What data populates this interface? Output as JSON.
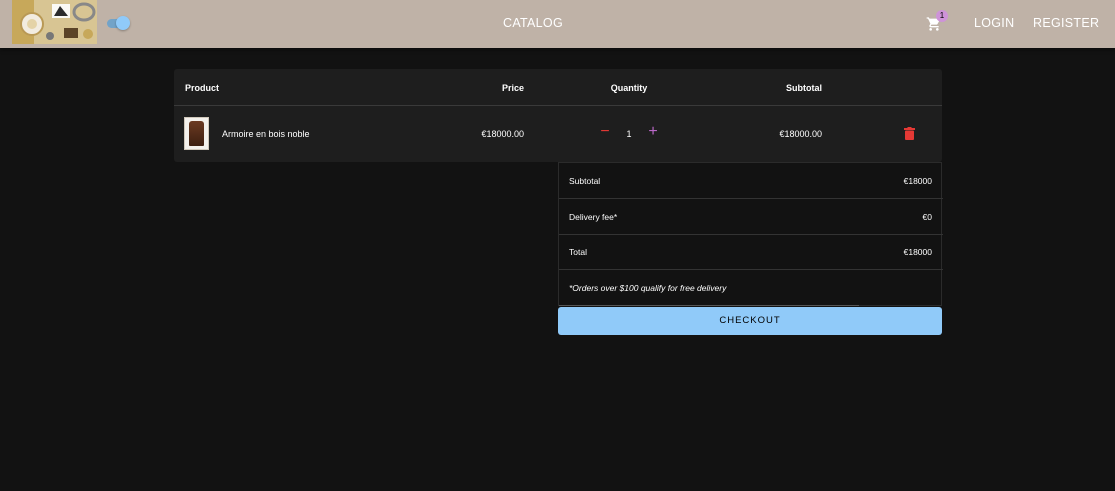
{
  "header": {
    "logo_icon": "shop-logo-image",
    "theme_toggle": {
      "checked": true,
      "color": "#90caf9"
    },
    "nav_center": "CATALOG",
    "cart": {
      "icon": "cart-icon",
      "badge": "1"
    },
    "login": "LOGIN",
    "register": "REGISTER",
    "background": "#bfb2a7"
  },
  "table": {
    "headers": {
      "product": "Product",
      "price": "Price",
      "quantity": "Quantity",
      "subtotal": "Subtotal"
    },
    "rows": [
      {
        "name": "Armoire en bois noble",
        "price": "€18000.00",
        "quantity": "1",
        "subtotal": "€18000.00",
        "thumb_icon": "armoire-thumbnail",
        "decrease_icon": "minus-icon",
        "increase_icon": "plus-icon",
        "delete_icon": "trash-icon"
      }
    ]
  },
  "summary": {
    "subtotal_label": "Subtotal",
    "subtotal_value": "€18000",
    "delivery_label": "Delivery fee*",
    "delivery_value": "€0",
    "total_label": "Total",
    "total_value": "€18000",
    "note": "*Orders over $100 qualify for free delivery"
  },
  "checkout_label": "CHECKOUT",
  "colors": {
    "background": "#121212",
    "surface": "#1e1e1e",
    "primary": "#90caf9",
    "danger": "#e53935",
    "secondary": "#ba68c8"
  }
}
